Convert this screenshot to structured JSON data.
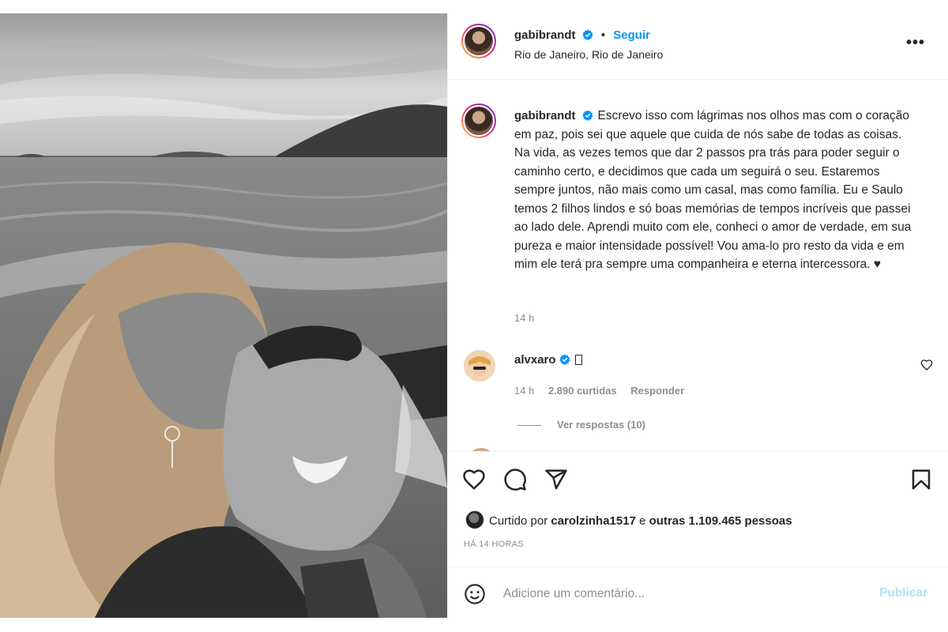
{
  "header": {
    "username": "gabibrandt",
    "separator": "•",
    "follow_label": "Seguir",
    "location": "Rio de Janeiro, Rio de Janeiro",
    "more_label": "•••"
  },
  "caption": {
    "username": "gabibrandt",
    "text": "Escrevo isso com lágrimas nos olhos mas com o coração em paz, pois sei que aquele que cuida de nós sabe de todas as coisas. Na vida, as vezes temos que dar 2 passos pra trás para poder seguir o caminho certo, e decidimos que cada um seguirá o seu. Estaremos sempre juntos, não mais como um casal, mas como família. Eu e Saulo temos 2 filhos lindos e só boas memórias de tempos incríveis que passei ao lado dele. Aprendi muito com ele, conheci o amor de verdade, em sua pureza e maior intensidade possível! Vou ama-lo pro resto da vida e em mim ele terá pra sempre uma companheira e eterna intercessora. ♥",
    "time": "14 h"
  },
  "reply": {
    "username": "alvxaro",
    "time": "14 h",
    "likes": "2.890 curtidas",
    "reply_label": "Responder",
    "view_replies": "Ver respostas (10)"
  },
  "likes": {
    "prefix": "Curtido por",
    "user": "carolzinha1517",
    "middle": "e",
    "others": "outras 1.109.465 pessoas"
  },
  "time_ago": "HÁ 14 HORAS",
  "comment": {
    "placeholder": "Adicione um comentário...",
    "publish_label": "Publicar"
  },
  "icons": {
    "verified": "verified-badge-icon",
    "heart": "heart-icon",
    "comment": "comment-icon",
    "share": "paper-plane-icon",
    "save": "bookmark-icon",
    "emoji": "emoji-icon"
  },
  "colors": {
    "accent": "#0095f6",
    "muted": "#8e8e8e",
    "publish_disabled": "#b2dffc"
  }
}
